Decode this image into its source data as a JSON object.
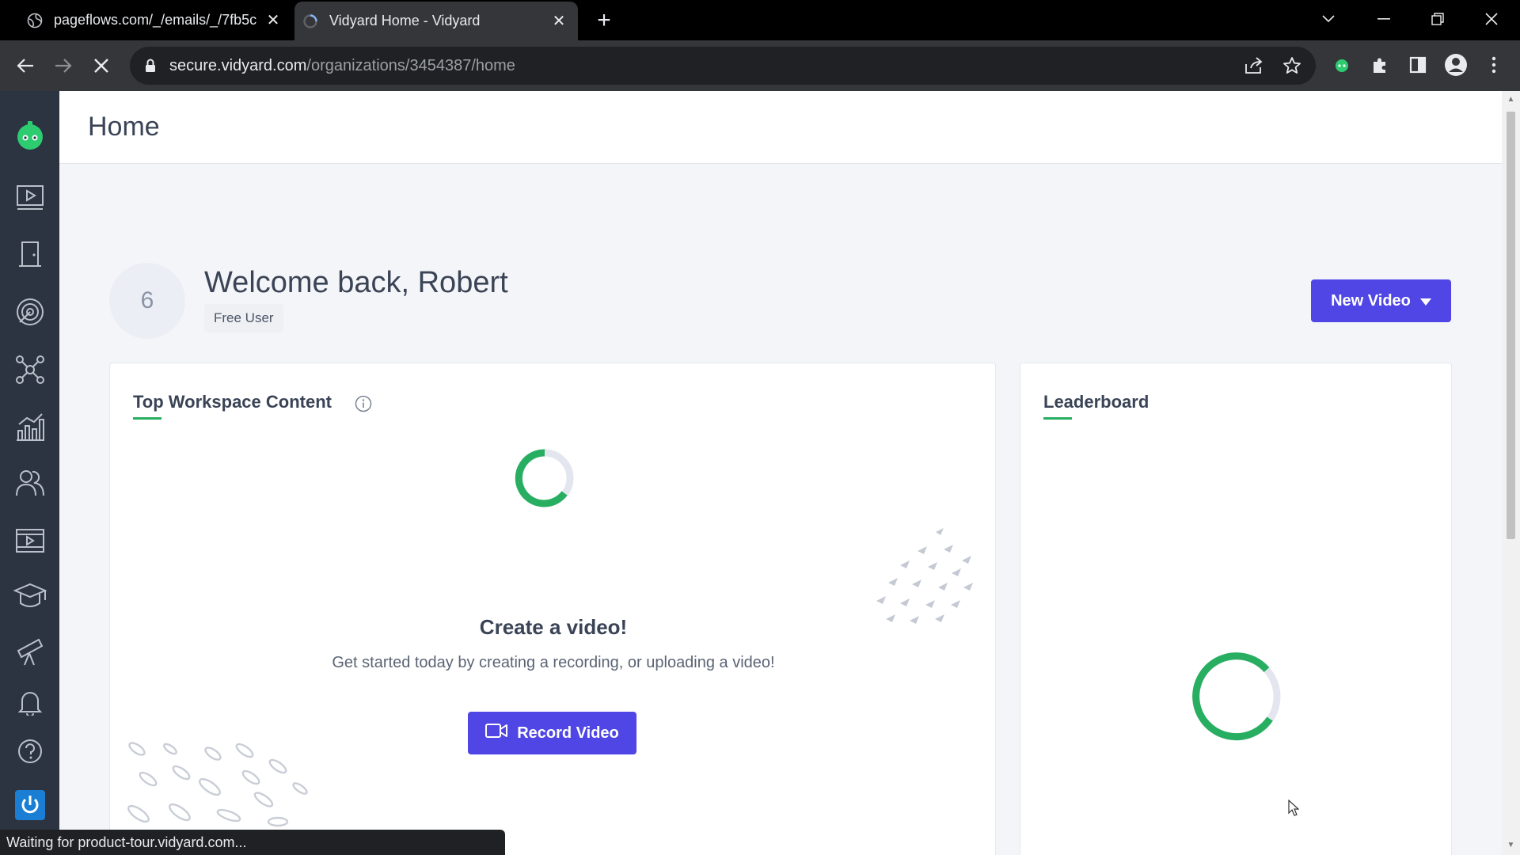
{
  "browser": {
    "tabs": [
      {
        "title": "pageflows.com/_/emails/_/7fb5c"
      },
      {
        "title": "Vidyard Home - Vidyard"
      }
    ],
    "url_host": "secure.vidyard.com",
    "url_path": "/organizations/3454387/home",
    "status_text": "Waiting for product-tour.vidyard.com..."
  },
  "sidebar": {
    "items": [
      {
        "name": "logo",
        "icon": "vidyard-bot-logo-icon"
      },
      {
        "name": "videos",
        "icon": "video-library-icon"
      },
      {
        "name": "workspace",
        "icon": "door-icon"
      },
      {
        "name": "prospecting",
        "icon": "target-icon"
      },
      {
        "name": "integrations",
        "icon": "network-icon"
      },
      {
        "name": "analytics",
        "icon": "bar-chart-icon"
      },
      {
        "name": "team",
        "icon": "users-icon"
      },
      {
        "name": "hubs",
        "icon": "video-player-icon"
      },
      {
        "name": "learning",
        "icon": "graduation-cap-icon"
      },
      {
        "name": "discover",
        "icon": "telescope-icon"
      },
      {
        "name": "notifications",
        "icon": "bell-icon"
      },
      {
        "name": "help",
        "icon": "help-icon"
      },
      {
        "name": "power",
        "icon": "power-icon"
      }
    ]
  },
  "page": {
    "title": "Home",
    "avatar_text": "6",
    "welcome": "Welcome back, Robert",
    "user_badge": "Free User",
    "new_video_label": "New Video"
  },
  "top_content": {
    "title": "Top Workspace Content",
    "empty_title": "Create a video!",
    "empty_desc": "Get started today by creating a recording, or uploading a video!",
    "record_label": "Record Video"
  },
  "leaderboard": {
    "title": "Leaderboard"
  },
  "colors": {
    "accent": "#4f46e5",
    "success": "#27ae60",
    "sidebar": "#2b3440"
  }
}
